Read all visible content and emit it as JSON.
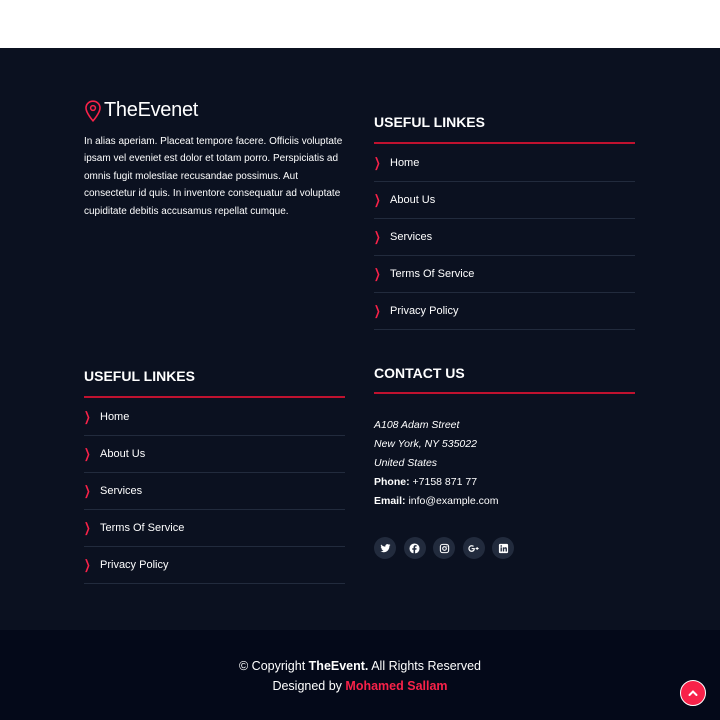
{
  "brand": {
    "name": "TheEvenet"
  },
  "about_text": "In alias aperiam. Placeat tempore facere. Officiis voluptate ipsam vel eveniet est dolor et totam porro. Perspiciatis ad omnis fugit molestiae recusandae possimus. Aut consectetur id quis. In inventore consequatur ad voluptate cupiditate debitis accusamus repellat cumque.",
  "links_right": {
    "title": "USEFUL LINKES",
    "items": [
      "Home",
      "About Us",
      "Services",
      "Terms Of Service",
      "Privacy Policy"
    ]
  },
  "links_left": {
    "title": "USEFUL LINKES",
    "items": [
      "Home",
      "About Us",
      "Services",
      "Terms Of Service",
      "Privacy Policy"
    ]
  },
  "contact": {
    "title": "CONTACT US",
    "address": [
      "A108 Adam Street",
      "New York, NY 535022",
      "United States"
    ],
    "phone_label": "Phone:",
    "phone": "+7158 871 77",
    "email_label": "Email:",
    "email": "info@example.com"
  },
  "socials": [
    "twitter-icon",
    "facebook-icon",
    "instagram-icon",
    "google-plus-icon",
    "linkedin-icon"
  ],
  "copyright": {
    "prefix": "© Copyright",
    "brand": "TheEvent.",
    "suffix": "All Rights Reserved",
    "designed_by": "Designed by",
    "designer": "Mohamed Sallam"
  },
  "colors": {
    "accent": "#f82249",
    "divider": "#c0122f",
    "bg": "#0b1120",
    "bottom_bg": "#040919"
  }
}
